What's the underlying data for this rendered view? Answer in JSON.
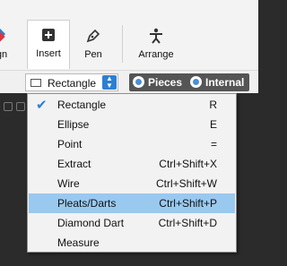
{
  "ribbon": {
    "buttons": [
      {
        "label": "sign",
        "icon": "design-icon"
      },
      {
        "label": "Insert",
        "icon": "insert-plus-icon"
      },
      {
        "label": "Pen",
        "icon": "pen-icon"
      },
      {
        "label": "Arrange",
        "icon": "arrange-icon"
      }
    ]
  },
  "toolbar": {
    "shape_value": "Rectangle",
    "pieces_label": "Pieces",
    "internal_label": "Internal"
  },
  "menu": {
    "selected_index": 5,
    "checked_index": 0,
    "items": [
      {
        "label": "Rectangle",
        "shortcut": "R"
      },
      {
        "label": "Ellipse",
        "shortcut": "E"
      },
      {
        "label": "Point",
        "shortcut": "="
      },
      {
        "label": "Extract",
        "shortcut": "Ctrl+Shift+X"
      },
      {
        "label": "Wire",
        "shortcut": "Ctrl+Shift+W"
      },
      {
        "label": "Pleats/Darts",
        "shortcut": "Ctrl+Shift+P"
      },
      {
        "label": "Diamond Dart",
        "shortcut": "Ctrl+Shift+D"
      },
      {
        "label": "Measure",
        "shortcut": ""
      }
    ]
  },
  "colors": {
    "accent": "#2d7fd1",
    "selection": "#99c9ef",
    "dark_background": "#2b2b2b"
  }
}
